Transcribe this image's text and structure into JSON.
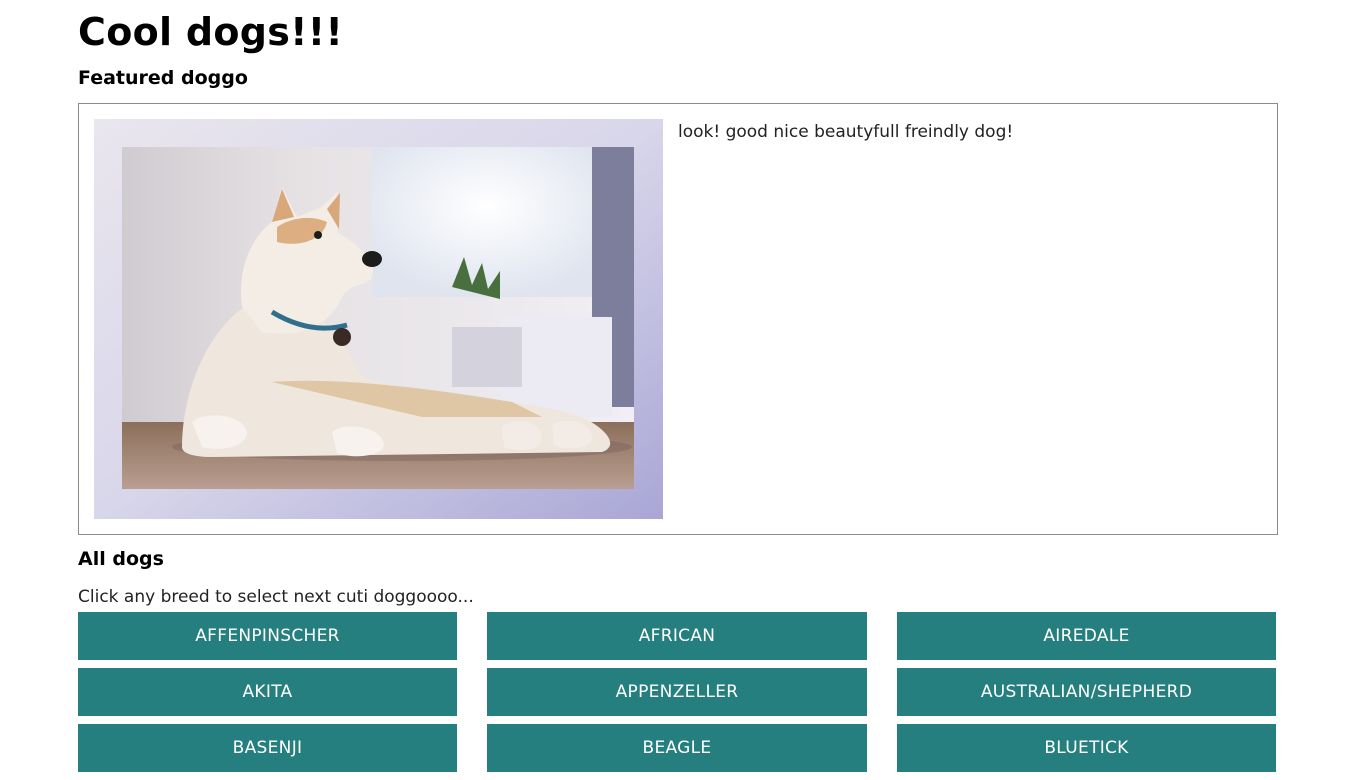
{
  "header": {
    "title": "Cool dogs!!!"
  },
  "featured": {
    "heading": "Featured doggo",
    "image_alt": "akita dog lying on floor",
    "description": "look! good nice beautyfull freindly dog!"
  },
  "all_dogs": {
    "heading": "All dogs",
    "hint": "Click any breed to select next cuti doggoooo...",
    "breeds": [
      {
        "label": "AFFENPINSCHER"
      },
      {
        "label": "AFRICAN"
      },
      {
        "label": "AIREDALE"
      },
      {
        "label": "AKITA"
      },
      {
        "label": "APPENZELLER"
      },
      {
        "label": "AUSTRALIAN/SHEPHERD"
      },
      {
        "label": "BASENJI"
      },
      {
        "label": "BEAGLE"
      },
      {
        "label": "BLUETICK"
      }
    ]
  },
  "colors": {
    "button_bg": "#267f7f",
    "button_text": "#ffffff",
    "card_border": "#8c8c8c"
  }
}
